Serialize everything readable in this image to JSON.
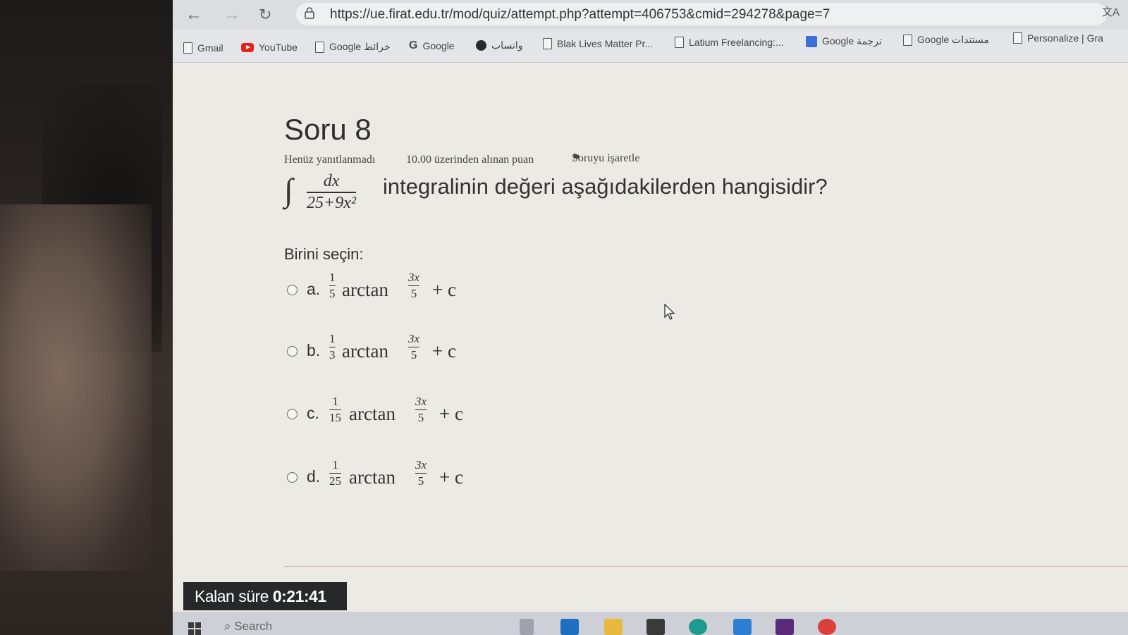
{
  "browser": {
    "url": "https://ue.firat.edu.tr/mod/quiz/attempt.php?attempt=406753&cmid=294278&page=7",
    "bookmarks": [
      {
        "label": "Gmail",
        "icon": "page-icon"
      },
      {
        "label": "YouTube",
        "icon": "youtube-icon"
      },
      {
        "label": "Google خرائط",
        "icon": "page-icon"
      },
      {
        "label": "Google",
        "icon": "google-icon"
      },
      {
        "label": "واتساب",
        "icon": "whatsapp-icon"
      },
      {
        "label": "Blak Lives Matter Pr...",
        "icon": "page-icon"
      },
      {
        "label": "Latium Freelancing:...",
        "icon": "page-icon"
      },
      {
        "label": "Google ترجمة",
        "icon": "translate-icon"
      },
      {
        "label": "Google مستندات",
        "icon": "page-icon"
      },
      {
        "label": "Personalize | Gra",
        "icon": "page-icon"
      }
    ]
  },
  "quiz": {
    "title": "Soru 8",
    "status": "Henüz yanıtlanmadı",
    "points": "10.00 üzerinden alınan puan",
    "flag_label": "Soruyu işaretle",
    "integral": {
      "numerator": "dx",
      "denominator": "25+9x²"
    },
    "question_text": "integralinin değeri aşağıdakilerden hangisidir?",
    "prompt": "Birini seçin:",
    "options": [
      {
        "letter": "a.",
        "coef_num": "1",
        "coef_den": "5",
        "fn": "arctan",
        "arg_num": "3x",
        "arg_den": "5",
        "tail": "+ c"
      },
      {
        "letter": "b.",
        "coef_num": "1",
        "coef_den": "3",
        "fn": "arctan",
        "arg_num": "3x",
        "arg_den": "5",
        "tail": "+ c"
      },
      {
        "letter": "c.",
        "coef_num": "1",
        "coef_den": "15",
        "fn": "arctan",
        "arg_num": "3x",
        "arg_den": "5",
        "tail": "+ c"
      },
      {
        "letter": "d.",
        "coef_num": "1",
        "coef_den": "25",
        "fn": "arctan",
        "arg_num": "3x",
        "arg_den": "5",
        "tail": "+ c"
      }
    ],
    "timer_label": "Kalan süre",
    "timer_value": "0:21:41"
  },
  "taskbar": {
    "search_placeholder": "Search"
  }
}
